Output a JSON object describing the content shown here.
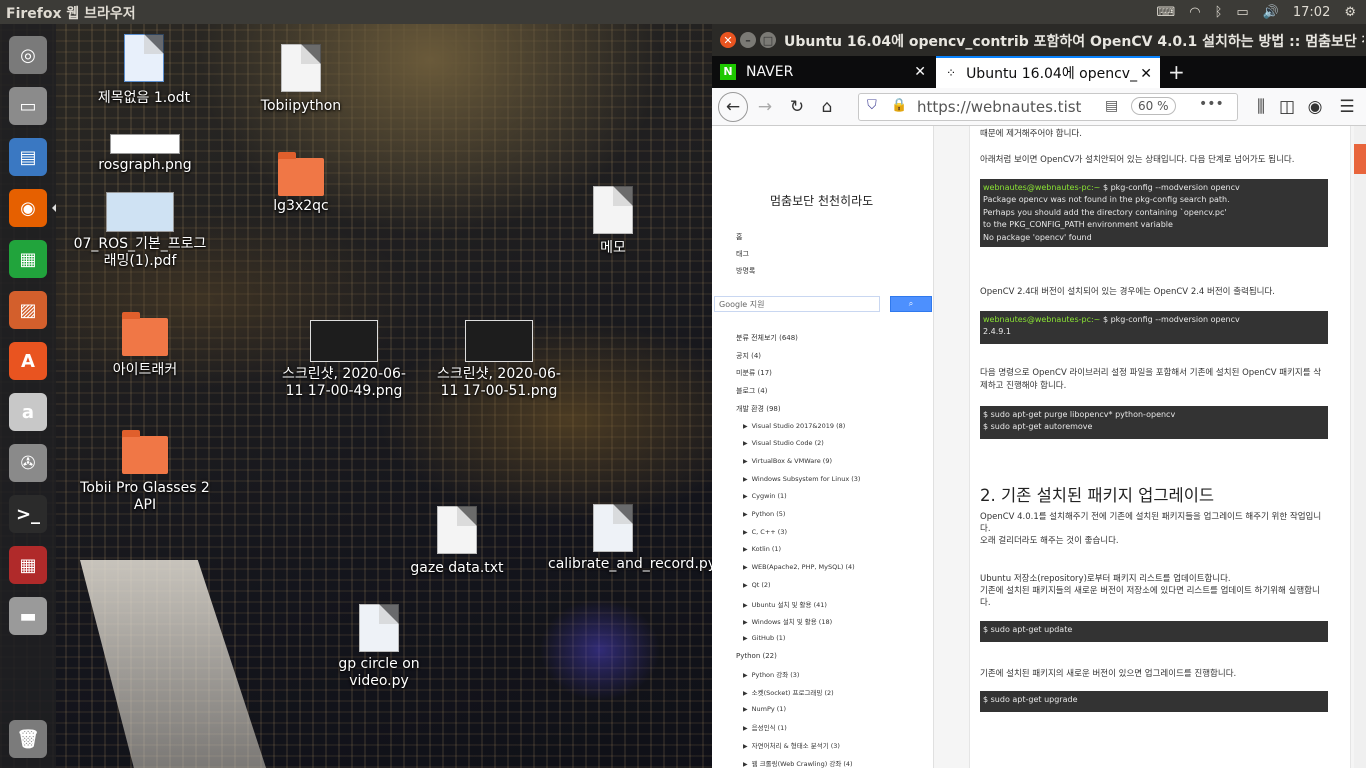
{
  "topbar": {
    "app_title": "Firefox 웹 브라우저",
    "clock": "17:02"
  },
  "launcher": [
    {
      "name": "ubuntu-dash-icon",
      "color": "#7a7a7a",
      "glyph": "◎"
    },
    {
      "name": "files-icon",
      "color": "#8b8b8b",
      "glyph": "▭"
    },
    {
      "name": "image-viewer-icon",
      "color": "#3a78c2",
      "glyph": "▤"
    },
    {
      "name": "firefox-icon",
      "color": "#e66000",
      "glyph": "◉"
    },
    {
      "name": "calc-icon",
      "color": "#21a43c",
      "glyph": "▦"
    },
    {
      "name": "impress-icon",
      "color": "#d35f2c",
      "glyph": "▨"
    },
    {
      "name": "software-center-icon",
      "color": "#e95420",
      "glyph": "A"
    },
    {
      "name": "amazon-icon",
      "color": "#c8c8c8",
      "glyph": "a"
    },
    {
      "name": "system-settings-icon",
      "color": "#8a8a8a",
      "glyph": "✇"
    },
    {
      "name": "terminal-icon",
      "color": "#2b2b2b",
      "glyph": ">_"
    },
    {
      "name": "workspace-switcher-icon",
      "color": "#b02a2a",
      "glyph": "▦"
    },
    {
      "name": "disk-icon",
      "color": "#9a9a9a",
      "glyph": "▬"
    },
    {
      "name": "trash-icon",
      "color": "#7b7b7b",
      "glyph": "🗑"
    }
  ],
  "desktop": [
    {
      "label": "제목없음 1.odt",
      "type": "doc"
    },
    {
      "label": "Tobiipython",
      "type": "doc"
    },
    {
      "label": "rosgraph.png",
      "type": "thumb"
    },
    {
      "label": "lg3x2qc",
      "type": "folder"
    },
    {
      "label": "07_ROS_기본_프로그래밍(1).pdf",
      "type": "thumb"
    },
    {
      "label": "메모",
      "type": "doc"
    },
    {
      "label": "아이트래커",
      "type": "folder"
    },
    {
      "label": "스크린샷, 2020-06-11 17-00-49.png",
      "type": "shot"
    },
    {
      "label": "스크린샷, 2020-06-11 17-00-51.png",
      "type": "shot"
    },
    {
      "label": "Tobii Pro Glasses 2 API",
      "type": "folder"
    },
    {
      "label": "gaze data.txt",
      "type": "doc"
    },
    {
      "label": "calibrate_and_record.py",
      "type": "py"
    },
    {
      "label": "gp circle on video.py",
      "type": "py"
    }
  ],
  "browser": {
    "window_title": "Ubuntu 16.04에 opencv_contrib 포함하여 OpenCV 4.0.1 설치하는 방법 :: 멈춤보단 천",
    "tabs": [
      {
        "label": "NAVER"
      },
      {
        "label": "Ubuntu 16.04에 opencv_"
      }
    ],
    "url": "https://webnautes.tist",
    "zoom": "60 %"
  },
  "sidebar": {
    "blog_title": "멈춤보단 천천히라도",
    "nav": [
      "홈",
      "태그",
      "방명록"
    ],
    "search_placeholder": "Google 지원",
    "categories": [
      {
        "label": "분류 전체보기 (648)",
        "level": 0
      },
      {
        "label": "공지 (4)",
        "level": 0
      },
      {
        "label": "미분류 (17)",
        "level": 0
      },
      {
        "label": "블로그 (4)",
        "level": 0
      },
      {
        "label": "개발 환경 (98)",
        "level": 0
      },
      {
        "label": "Visual Studio 2017&2019 (8)",
        "level": 1
      },
      {
        "label": "Visual Studio Code (2)",
        "level": 1
      },
      {
        "label": "VirtualBox & VMWare (9)",
        "level": 1
      },
      {
        "label": "Windows Subsystem for Linux (3)",
        "level": 1
      },
      {
        "label": "Cygwin (1)",
        "level": 1
      },
      {
        "label": "Python (5)",
        "level": 1
      },
      {
        "label": "C, C++ (3)",
        "level": 1
      },
      {
        "label": "Kotlin (1)",
        "level": 1
      },
      {
        "label": "WEB(Apache2, PHP, MySQL) (4)",
        "level": 1
      },
      {
        "label": "Qt (2)",
        "level": 1
      },
      {
        "label": "Ubuntu 설치 및 활용 (41)",
        "level": 1
      },
      {
        "label": "Windows 설치 및 활용 (18)",
        "level": 1
      },
      {
        "label": "GitHub (1)",
        "level": 1
      },
      {
        "label": "Python (22)",
        "level": 0
      },
      {
        "label": "Python 강좌 (3)",
        "level": 1
      },
      {
        "label": "소켓(Socket) 프로그래밍 (2)",
        "level": 1
      },
      {
        "label": "NumPy (1)",
        "level": 1
      },
      {
        "label": "음성인식 (1)",
        "level": 1
      },
      {
        "label": "자연어처리 & 형태소 분석기 (3)",
        "level": 1
      },
      {
        "label": "웹 크롤링(Web Crawling) 강좌 (4)",
        "level": 1
      }
    ]
  },
  "article": {
    "p0": "때문에 제거해주어야 합니다.",
    "p1": "아래처럼 보이면 OpenCV가 설치안되어 있는 상태입니다. 다음 단계로 넘어가도  됩니다.",
    "code1": {
      "prompt": "webnautes@webnautes-pc:~",
      "cmd": "$ pkg-config --modversion opencv",
      "lines": [
        "Package opencv was not found in the pkg-config search path.",
        "Perhaps you should add the directory containing `opencv.pc'",
        "to the PKG_CONFIG_PATH environment variable",
        "No package 'opencv' found"
      ]
    },
    "p2": "OpenCV 2.4대 버전이 설치되어 있는 경우에는 OpenCV  2.4 버전이 출력됩니다.",
    "code2": {
      "prompt": "webnautes@webnautes-pc:~",
      "cmd": "$ pkg-config --modversion opencv",
      "lines": [
        "2.4.9.1"
      ]
    },
    "p3a": "다음 명령으로 OpenCV 라이브러리 설정 파일을 포함해서 기존에 설치된 OpenCV 패키지를 삭",
    "p3b": "제하고 진행해야 합니다.",
    "code3": [
      "$ sudo apt-get purge  libopencv* python-opencv",
      "$ sudo apt-get autoremove"
    ],
    "h2": "2. 기존 설치된 패키지 업그레이드",
    "p4a": "OpenCV 4.0.1를 설치해주기 전에 기존에 설치된 패키지들을 업그레이드 해주기 위한 작업입니",
    "p4b": "다.",
    "p4c": "오래 걸리더라도 해주는 것이 좋습니다.",
    "p5a": "Ubuntu 저장소(repository)로부터 패키지 리스트를 업데이트합니다.",
    "p5b": "기존에 설치된 패키지들의 새로운 버전이 저장소에 있다면 리스트를 업데이트 하기위해 실행합니",
    "p5c": "다.",
    "code4": "$ sudo apt-get update",
    "p6": "기존에 설치된 패키지의 새로운 버전이 있으면 업그레이드를 진행합니다.",
    "code5": "$ sudo apt-get upgrade"
  }
}
